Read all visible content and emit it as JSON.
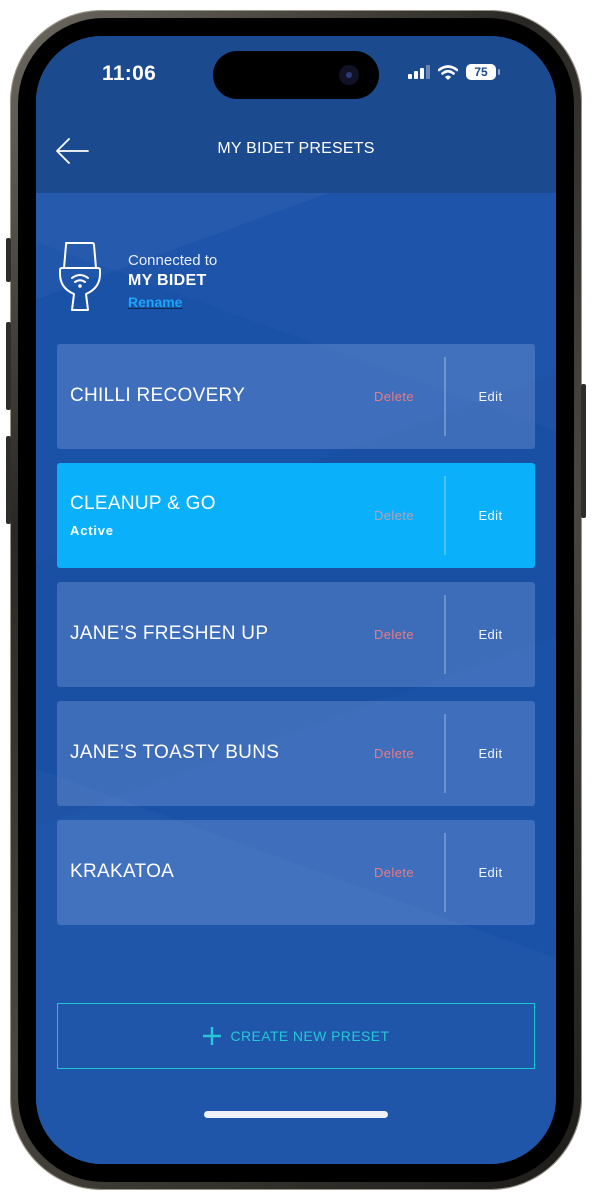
{
  "status_bar": {
    "time": "11:06",
    "battery": "75",
    "signal_icon": "cellular-signal-icon",
    "wifi_icon": "wifi-icon"
  },
  "header": {
    "title": "MY BIDET PRESETS",
    "back_icon": "arrow-left-icon"
  },
  "device": {
    "icon": "smart-toilet-icon",
    "connected_label": "Connected to",
    "name": "MY BIDET",
    "rename_label": "Rename"
  },
  "presets": [
    {
      "name": "CHILLI RECOVERY",
      "status": "",
      "delete_label": "Delete",
      "edit_label": "Edit"
    },
    {
      "name": "CLEANUP & GO",
      "status": "Active",
      "delete_label": "Delete",
      "edit_label": "Edit"
    },
    {
      "name": "JANE’S FRESHEN UP",
      "status": "",
      "delete_label": "Delete",
      "edit_label": "Edit"
    },
    {
      "name": "JANE’S TOASTY BUNS",
      "status": "",
      "delete_label": "Delete",
      "edit_label": "Edit"
    },
    {
      "name": "KRAKATOA",
      "status": "",
      "delete_label": "Delete",
      "edit_label": "Edit"
    }
  ],
  "create_button": {
    "label": "CREATE NEW PRESET",
    "icon": "plus-icon"
  },
  "colors": {
    "background": "#1a52a8",
    "header": "#1b4a8f",
    "active_preset": "#0bb0fb",
    "delete": "#e87c86",
    "accent_cyan": "#25c8d6",
    "link": "#1fa3f5"
  }
}
